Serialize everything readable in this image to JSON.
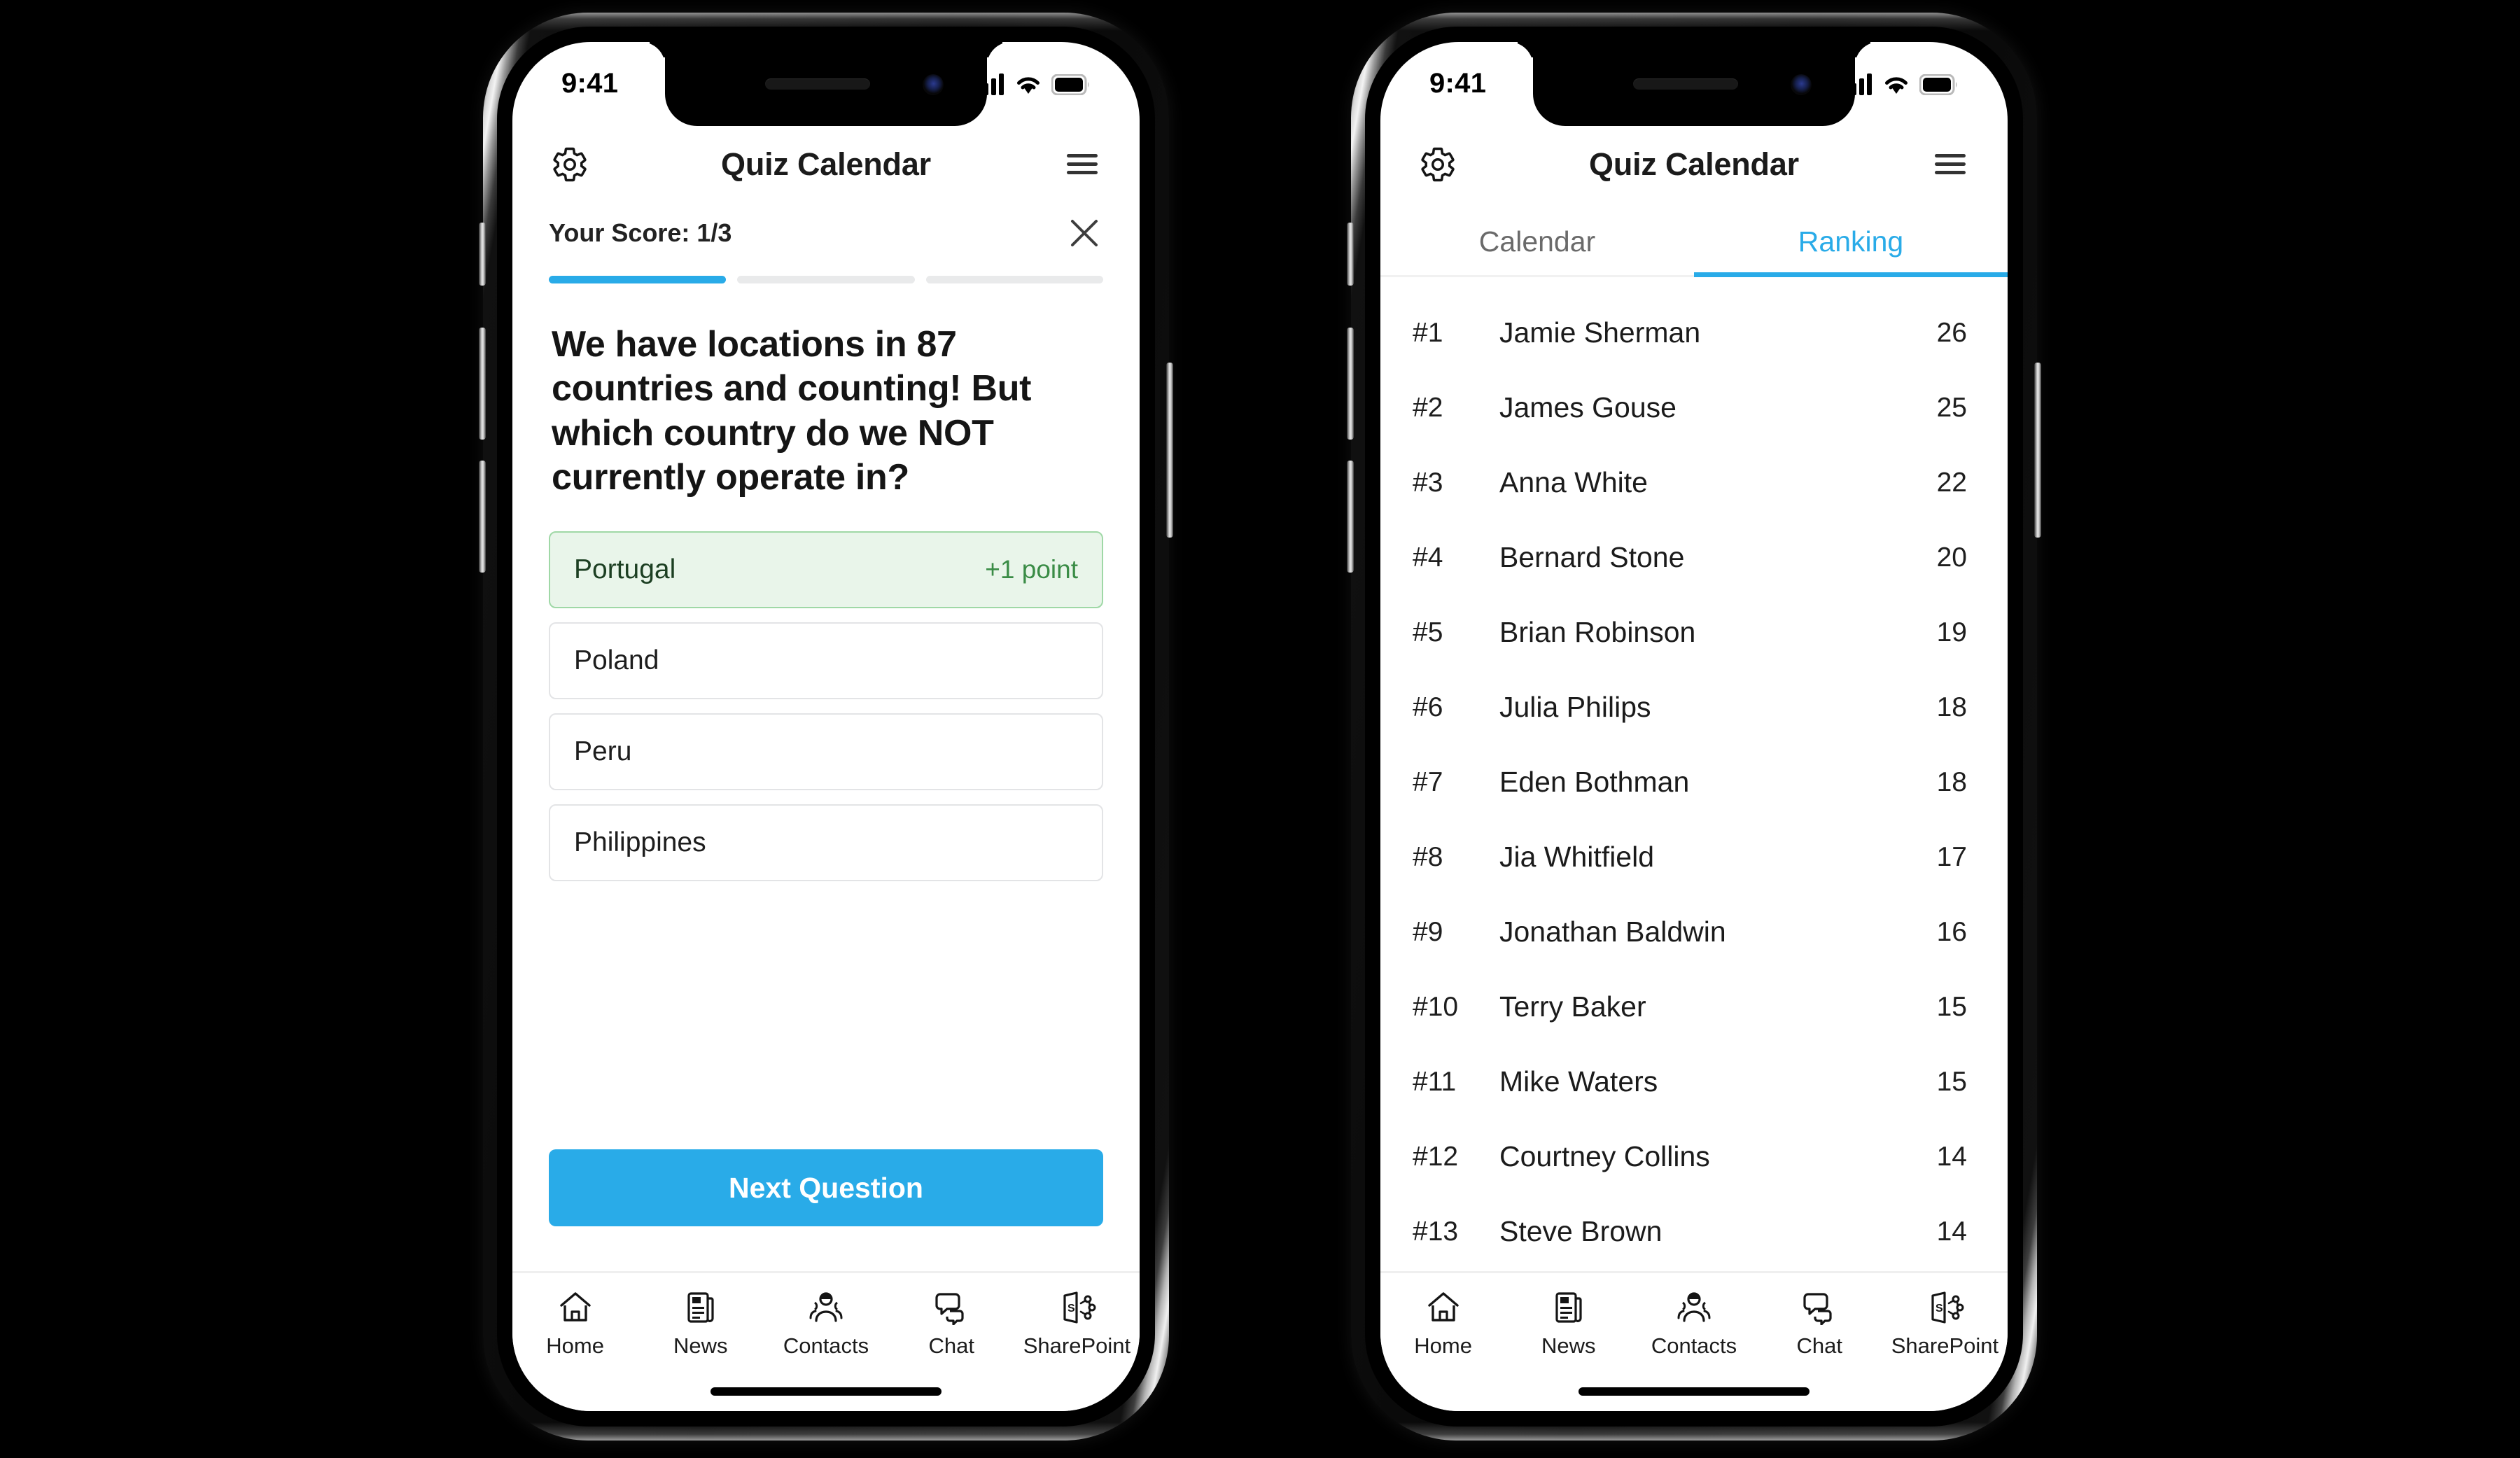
{
  "status_bar": {
    "time": "9:41",
    "icons": [
      "signal-icon",
      "wifi-icon",
      "battery-icon"
    ]
  },
  "colors": {
    "accent": "#29abe8",
    "correct_bg": "#e9f5ea",
    "correct_border": "#9fd8a6",
    "correct_text": "#3a8c46",
    "progress_track": "#e9eaeb"
  },
  "header": {
    "title": "Quiz Calendar",
    "settings_icon": "gear-icon",
    "menu_icon": "hamburger-menu-icon"
  },
  "quiz": {
    "score_label": "Your Score: 1/3",
    "close_icon": "close-icon",
    "progress": {
      "total": 3,
      "completed": 1
    },
    "question": "We have locations  in 87 countries and counting! But which country do we NOT currently operate in?",
    "options": [
      {
        "label": "Portugal",
        "points": "+1 point",
        "state": "correct"
      },
      {
        "label": "Poland",
        "points": "",
        "state": "default"
      },
      {
        "label": "Peru",
        "points": "",
        "state": "default"
      },
      {
        "label": "Philippines",
        "points": "",
        "state": "default"
      }
    ],
    "next_button": "Next Question"
  },
  "ranking": {
    "tabs": [
      {
        "label": "Calendar",
        "active": false
      },
      {
        "label": "Ranking",
        "active": true
      }
    ],
    "rows": [
      {
        "pos": "#1",
        "name": "Jamie Sherman",
        "score": "26"
      },
      {
        "pos": "#2",
        "name": "James Gouse",
        "score": "25"
      },
      {
        "pos": "#3",
        "name": "Anna White",
        "score": "22"
      },
      {
        "pos": "#4",
        "name": "Bernard Stone",
        "score": "20"
      },
      {
        "pos": "#5",
        "name": "Brian Robinson",
        "score": "19"
      },
      {
        "pos": "#6",
        "name": "Julia Philips",
        "score": "18"
      },
      {
        "pos": "#7",
        "name": "Eden Bothman",
        "score": "18"
      },
      {
        "pos": "#8",
        "name": "Jia Whitfield",
        "score": "17"
      },
      {
        "pos": "#9",
        "name": "Jonathan Baldwin",
        "score": "16"
      },
      {
        "pos": "#10",
        "name": "Terry Baker",
        "score": "15"
      },
      {
        "pos": "#11",
        "name": "Mike Waters",
        "score": "15"
      },
      {
        "pos": "#12",
        "name": "Courtney Collins",
        "score": "14"
      },
      {
        "pos": "#13",
        "name": "Steve Brown",
        "score": "14"
      }
    ]
  },
  "bottom_nav": [
    {
      "label": "Home",
      "icon": "home-icon"
    },
    {
      "label": "News",
      "icon": "newspaper-icon"
    },
    {
      "label": "Contacts",
      "icon": "contacts-people-icon"
    },
    {
      "label": "Chat",
      "icon": "chat-bubbles-icon"
    },
    {
      "label": "SharePoint",
      "icon": "sharepoint-icon"
    }
  ]
}
